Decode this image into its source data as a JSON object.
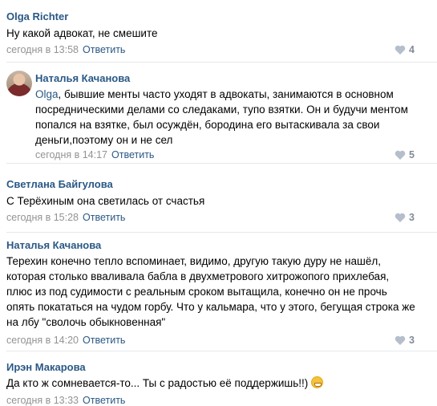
{
  "comments": [
    {
      "author": "Olga Richter",
      "text": "Ну какой адвокат, не смешите",
      "time": "сегодня в 13:58",
      "reply": "Ответить",
      "likes": "4"
    },
    {
      "author": "Наталья Качанова",
      "mention": "Olga",
      "text": ", бывшие менты часто уходят в адвокаты, занимаются в основном посредническими делами со следаками, тупо взятки. Он и будучи ментом попался на взятке, был осуждён, бородина его вытаскивала за свои деньги,поэтому он и не сел",
      "time": "сегодня в 14:17",
      "reply": "Ответить",
      "likes": "5"
    },
    {
      "author": "Светлана Байгулова",
      "text": "С Терёхиным она светилась от счастья",
      "time": "сегодня в 15:28",
      "reply": "Ответить",
      "likes": "3"
    },
    {
      "author": "Наталья Качанова",
      "text": "Терехин конечно тепло вспоминает, видимо, другую такую дуру не нашёл, которая столько вваливала бабла в двухметрового хитрожопого прихлебая, плюс из под судимости с реальным сроком вытащила, конечно он не прочь опять покататься на чудом горбу. Что у кальмара, что у этого, бегущая строка же на лбу \"сволочь обыкновенная\"",
      "time": "сегодня в 14:20",
      "reply": "Ответить",
      "likes": "3"
    },
    {
      "author": "Ирэн Макарова",
      "text": "Да кто ж сомневается-то... Ты с радостью её поддержишь!!)",
      "emoji": "grinning-face-emoji",
      "time": "сегодня в 13:33",
      "reply": "Ответить"
    }
  ],
  "icons": {
    "like": "heart-icon"
  },
  "colors": {
    "link": "#2a5885",
    "meta": "#939393",
    "divider": "#e7e8ec"
  }
}
